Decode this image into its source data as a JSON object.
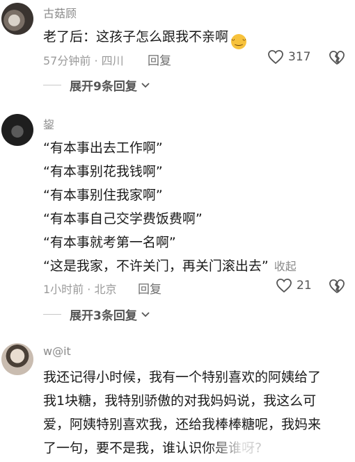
{
  "comments": [
    {
      "username": "古菇顾",
      "lines": [
        "老了后：这孩子怎么跟我不亲啊"
      ],
      "emoji": "😅",
      "meta": "57分钟前 · 四川",
      "reply_label": "回复",
      "likes": "317",
      "expand_label": "展开9条回复"
    },
    {
      "username": "鋆",
      "lines": [
        "“有本事出去工作啊”",
        "“有本事别花我钱啊”",
        "“有本事别住我家啊”",
        "“有本事自己交学费饭费啊”",
        "“有本事就考第一名啊”",
        "“这是我家，不许关门，再关门滚出去”"
      ],
      "fold_label": "收起",
      "meta": "1小时前 · 北京",
      "reply_label": "回复",
      "likes": "21",
      "expand_label": "展开3条回复"
    },
    {
      "username": "w@it",
      "lines": [
        "我还记得小时候，我有一个特别喜欢的阿姨给了",
        "我1块糖，我特别骄傲的对我妈妈说，我这么可",
        "爱，阿姨特别喜欢我，还给我棒棒糖呢，我妈来",
        "了一句，要不是我，谁认识你是谁呀?"
      ]
    }
  ],
  "colors": {
    "text": "#1a1a1a",
    "meta": "#9a9a9a",
    "username": "#8a8a8a",
    "emoji": "#f7c23c"
  },
  "icons": [
    "heart-outline-icon",
    "broken-heart-icon",
    "chevron-down-icon"
  ]
}
